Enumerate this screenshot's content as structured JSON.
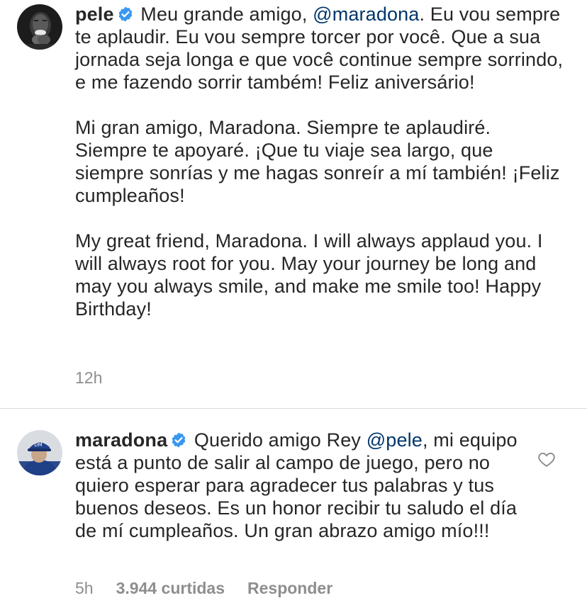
{
  "comments": [
    {
      "username": "pele",
      "verified": true,
      "mention": "@maradona",
      "text_prefix": "Meu grande amigo, ",
      "text_after_mention": ". Eu vou sempre te aplaudir. Eu vou sempre torcer por você. Que a sua jornada seja longa e que você continue sempre sorrindo, e me fazendo sorrir também! Feliz aniversário!",
      "paragraph_2": "Mi gran amigo, Maradona. Siempre te aplaudiré. Siempre te apoyaré. ¡Que tu viaje sea largo, que siempre sonrías y me hagas sonreír a mí también! ¡Feliz cumpleaños!",
      "paragraph_3": "My great friend, Maradona. I will always applaud you. I will always root for you. May your journey be long and may you always smile, and make me smile too! Happy Birthday!",
      "time": "12h"
    },
    {
      "username": "maradona",
      "verified": true,
      "text_prefix": "Querido amigo Rey ",
      "mention": "@pele",
      "text_after_mention": ", mi equipo está a punto de salir al campo de juego, pero no quiero esperar para agradecer tus palabras y tus buenos deseos. Es un honor recibir tu saludo el día de mí cumpleaños. Un gran abrazo amigo mío!!!",
      "time": "5h",
      "likes": "3.944 curtidas",
      "reply_label": "Responder"
    }
  ],
  "icons": {
    "verified": "verified-badge-icon",
    "like": "heart-icon"
  },
  "colors": {
    "text": "#262626",
    "mention": "#00376b",
    "secondary": "#8e8e8e",
    "verified": "#3897f0",
    "divider": "#dbdbdb"
  }
}
